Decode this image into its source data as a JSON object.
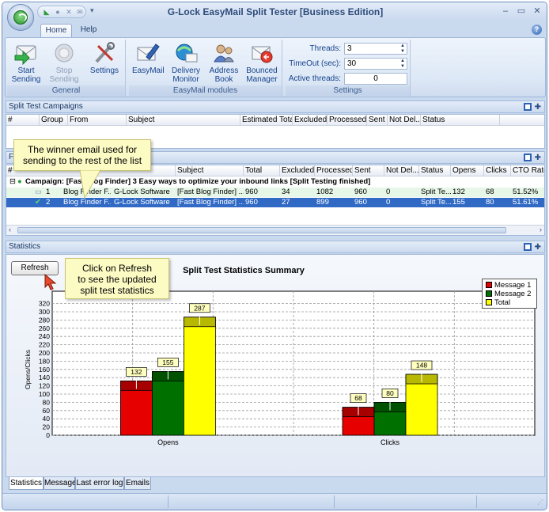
{
  "window": {
    "title": "G-Lock EasyMail Split Tester [Business Edition]"
  },
  "tabs": [
    {
      "label": "Home",
      "active": true
    },
    {
      "label": "Help",
      "active": false
    }
  ],
  "ribbon": {
    "groups": [
      {
        "label": "General",
        "buttons": [
          {
            "label": "Start\nSending",
            "icon": "start-sending-icon",
            "enabled": true
          },
          {
            "label": "Stop\nSending",
            "icon": "stop-sending-icon",
            "enabled": false
          },
          {
            "label": "Settings",
            "icon": "settings-tools-icon",
            "enabled": true
          }
        ]
      },
      {
        "label": "EasyMail modules",
        "buttons": [
          {
            "label": "EasyMail",
            "icon": "easymail-icon",
            "enabled": true
          },
          {
            "label": "Delivery\nMonitor",
            "icon": "delivery-monitor-icon",
            "enabled": true
          },
          {
            "label": "Address\nBook",
            "icon": "address-book-icon",
            "enabled": true
          },
          {
            "label": "Bounced\nManager",
            "icon": "bounced-manager-icon",
            "enabled": true
          }
        ]
      },
      {
        "label": "Settings"
      }
    ],
    "settings": {
      "threads_label": "Threads:",
      "threads_value": "3",
      "timeout_label": "TimeOut (sec):",
      "timeout_value": "30",
      "active_label": "Active threads:",
      "active_value": "0"
    }
  },
  "campaigns_panel": {
    "title": "Split Test Campaigns",
    "columns": [
      "#",
      "Group",
      "From",
      "Subject",
      "Estimated Total",
      "Excluded",
      "Processed",
      "Sent",
      "Not Del...",
      "Status"
    ]
  },
  "messages_panel": {
    "title_fragment": "F",
    "columns": [
      "#",
      "Subject",
      "Total",
      "Excluded",
      "Processed",
      "Sent",
      "Not Del...",
      "Status",
      "Opens",
      "Clicks",
      "CTO Rate"
    ],
    "campaign_row": "Campaign: [Fast Blog Finder] 3 Easy ways to optimize your inbound links [Split Testing finished]",
    "rows": [
      {
        "num": "1",
        "from_name": "Blog Finder F...",
        "from_company": "G-Lock Software",
        "subject": "[Fast Blog Finder] ...",
        "total": "960",
        "excluded": "34",
        "processed": "1082",
        "sent": "960",
        "notdel": "0",
        "status": "Split Te...",
        "opens": "132",
        "clicks": "68",
        "cto": "51.52%",
        "selected": false
      },
      {
        "num": "2",
        "from_name": "Blog Finder F...",
        "from_company": "G-Lock Software",
        "subject": "[Fast Blog Finder] ...",
        "total": "960",
        "excluded": "27",
        "processed": "899",
        "sent": "960",
        "notdel": "0",
        "status": "Split Te...",
        "opens": "155",
        "clicks": "80",
        "cto": "51.61%",
        "selected": true
      }
    ]
  },
  "callouts": {
    "winner": "The winner email used for\nsending to the rest of the list",
    "refresh": "Click on Refresh\nto see the updated\nsplit test statistics"
  },
  "stats_panel": {
    "title": "Statistics",
    "refresh_label": "Refresh"
  },
  "chart_data": {
    "type": "bar",
    "title": "Split Test Statistics Summary",
    "ylabel": "Opens/Clicks",
    "categories": [
      "Opens",
      "Clicks"
    ],
    "series": [
      {
        "name": "Message 1",
        "values": [
          132,
          68
        ],
        "color": "#e60000"
      },
      {
        "name": "Message 2",
        "values": [
          155,
          80
        ],
        "color": "#007000"
      },
      {
        "name": "Total",
        "values": [
          287,
          148
        ],
        "color": "#ffff00"
      }
    ],
    "yticks": [
      0,
      20,
      40,
      60,
      80,
      100,
      120,
      140,
      160,
      180,
      200,
      220,
      240,
      260,
      280,
      300,
      320
    ],
    "ylim": [
      0,
      350
    ],
    "grid": true,
    "legend": "top-right"
  },
  "bottom_tabs": [
    {
      "label": "Statistics",
      "active": true
    },
    {
      "label": "Message",
      "active": false
    },
    {
      "label": "Last error log",
      "active": false
    },
    {
      "label": "Emails",
      "active": false
    }
  ]
}
